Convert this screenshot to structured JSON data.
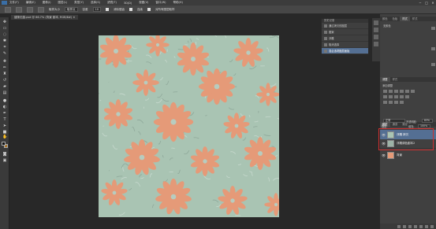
{
  "menubar": {
    "items": [
      "文件(F)",
      "编辑(E)",
      "图像(I)",
      "图层(L)",
      "类型(Y)",
      "选择(S)",
      "滤镜(T)",
      "3D(D)",
      "视图(V)",
      "窗口(W)",
      "帮助(H)"
    ],
    "window_controls": [
      "─",
      "□",
      "✕"
    ]
  },
  "options": {
    "sample_label": "取样大小",
    "sample_value": "取样点",
    "tolerance_label": "容差",
    "tolerance_value": "10",
    "antialias_label": "消除锯齿",
    "contiguous_label": "连续",
    "all_layers_label": "对所有图层取样"
  },
  "document": {
    "tab_label": "缝隙无缝.psd @ 66.7% (背景 副本, RGB/8#) ✕"
  },
  "history": {
    "header": "历史记录",
    "items": [
      {
        "label": "通过拷贝的图层",
        "selected": false
      },
      {
        "label": "图案",
        "selected": false
      },
      {
        "label": "浮雕",
        "selected": false
      },
      {
        "label": "取消选择",
        "selected": false
      },
      {
        "label": "混合选项图层面板",
        "selected": true
      }
    ]
  },
  "panels": {
    "top_tabs": [
      "颜色",
      "色板",
      "样式",
      "样式"
    ],
    "top_label": "无颜色",
    "adjust_tabs": [
      "调整",
      "样式"
    ],
    "adjust_label": "添加调整"
  },
  "layers": {
    "tabs": [
      "图层",
      "通道",
      "路径"
    ],
    "kind_label": "类型",
    "blend_mode": "正常",
    "opacity_label": "不透明度:",
    "opacity_value": "83%",
    "lock_label": "锁定:",
    "fill_label": "填充:",
    "fill_value": "100%",
    "items": [
      {
        "name": "浮雕 拷贝",
        "selected": true
      },
      {
        "name": "浮雕调色副本2",
        "selected": false
      },
      {
        "name": "背景",
        "selected": false
      }
    ]
  },
  "colors": {
    "canvas_bg": "#a9c4b3",
    "petal": "#e59a78",
    "selection": "#546f93",
    "highlight_box": "#d03030"
  }
}
